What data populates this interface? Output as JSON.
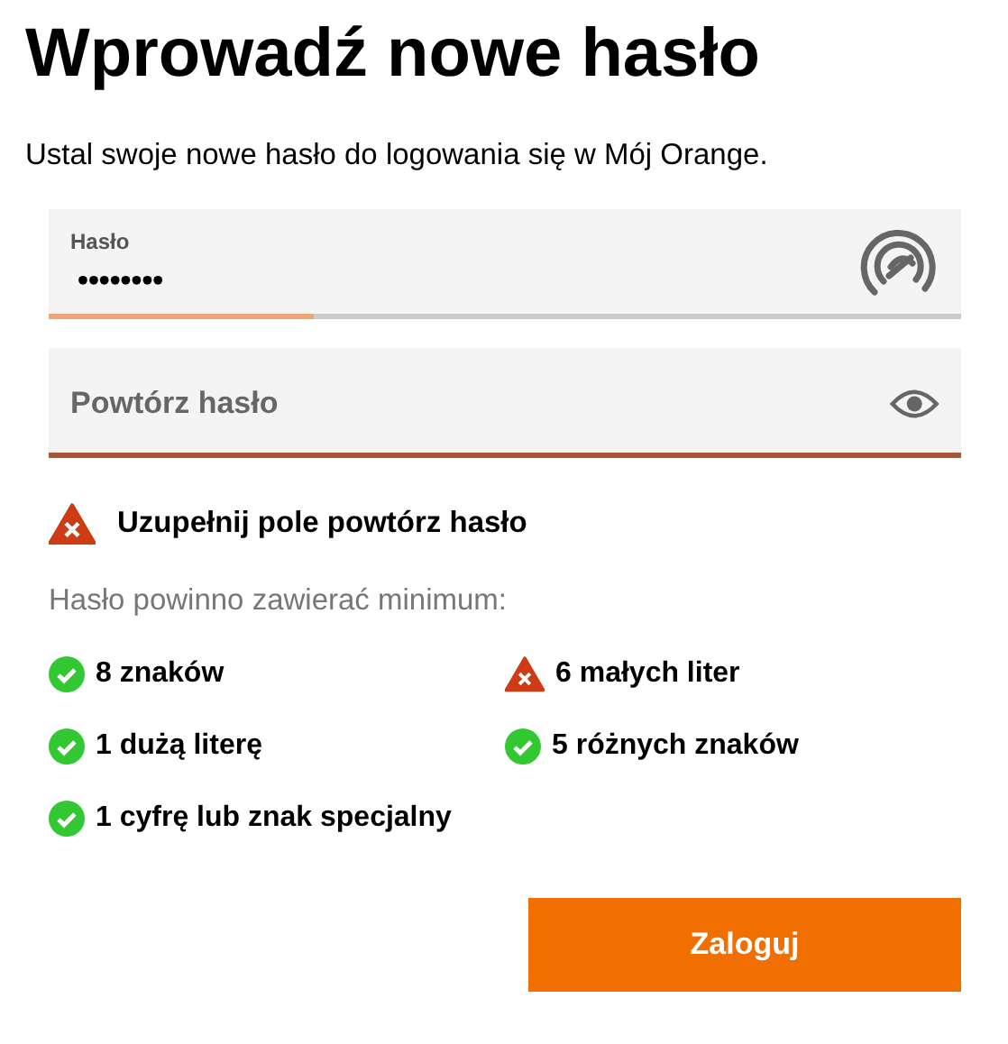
{
  "title": "Wprowadź nowe hasło",
  "subtitle": "Ustal swoje nowe hasło do logowania się w Mój Orange.",
  "password_field": {
    "label": "Hasło",
    "value": "••••••••",
    "level": 0.29
  },
  "repeat_field": {
    "placeholder": "Powtórz hasło",
    "error": true
  },
  "error_message": "Uzupełnij pole powtórz hasło",
  "requirements_intro": "Hasło powinno zawierać minimum:",
  "requirements": [
    {
      "text": "8 znaków",
      "met": true
    },
    {
      "text": "6 małych liter",
      "met": false
    },
    {
      "text": "1 dużą literę",
      "met": true
    },
    {
      "text": "5 różnych znaków",
      "met": true
    },
    {
      "text": "1 cyfrę lub znak specjalny",
      "met": true
    }
  ],
  "button": "Zaloguj"
}
